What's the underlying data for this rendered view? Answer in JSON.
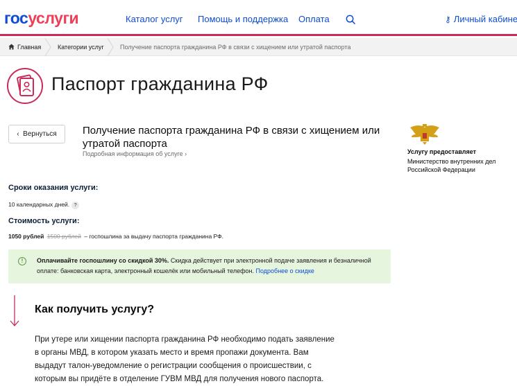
{
  "header": {
    "logo_part1": "гос",
    "logo_part2": "услуги",
    "nav_catalog": "Каталог услуг",
    "nav_help": "Помощь и поддержка",
    "nav_pay": "Оплата",
    "cabinet": "Личный кабинет"
  },
  "breadcrumb": {
    "home": "Главная",
    "categories": "Категории услуг",
    "current": "Получение паспорта гражданина РФ в связи с хищением или утратой паспорта"
  },
  "page": {
    "title": "Паспорт гражданина РФ",
    "back_label": "Вернуться",
    "service_title": "Получение паспорта гражданина РФ в связи с хищением или утратой паспорта",
    "more_info": "Подробная информация об услуге"
  },
  "provider": {
    "label": "Услугу предоставляет",
    "name": "Министерство внутренних дел Российской Федерации"
  },
  "terms": {
    "heading": "Сроки оказания услуги:",
    "value": "10 календарных дней.",
    "help": "?"
  },
  "cost": {
    "heading": "Стоимость услуги:",
    "price": "1050 рублей",
    "old_price": "1500 рублей",
    "description": "– госпошлина за выдачу паспорта гражданина РФ."
  },
  "discount": {
    "icon": "!",
    "bold": "Оплачивайте госпошлину со скидкой 30%.",
    "text": "Скидка действует при электронной подаче заявления и безналичной оплате: банковская карта, электронный кошелёк или мобильный телефон.",
    "link": "Подробнее о скидке"
  },
  "how": {
    "heading": "Как получить услугу?",
    "text": "При утере или хищении паспорта гражданина РФ необходимо подать заявление в органы МВД, в котором указать место и время пропажи документа. Вам выдадут талон-уведомление о регистрации сообщения о происшествии, с которым вы придёте в отделение ГУВМ МВД для получения нового паспорта."
  },
  "colors": {
    "brand_blue": "#0d4cd3",
    "brand_red": "#ee3f58",
    "accent": "#c92c5a",
    "banner_bg": "#e6f5dd"
  },
  "icons": [
    "search-icon",
    "key-icon",
    "home-icon",
    "passport-icon",
    "chevron-left-icon",
    "chevron-right-icon",
    "coat-of-arms-icon",
    "info-icon",
    "arrow-down-icon"
  ]
}
